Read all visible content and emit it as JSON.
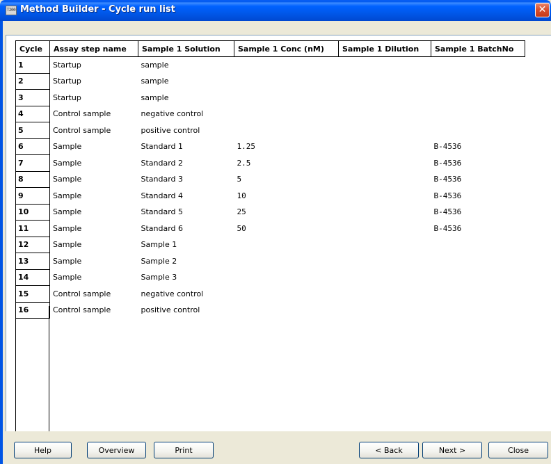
{
  "window": {
    "title": "Method Builder - Cycle run list",
    "icon_text": "T200",
    "close_glyph": "✕"
  },
  "table": {
    "headers": [
      "Cycle",
      "Assay step name",
      "Sample 1 Solution",
      "Sample 1 Conc (nM)",
      "Sample 1 Dilution",
      "Sample 1 BatchNo"
    ],
    "rows": [
      {
        "cycle": "1",
        "step": "Startup",
        "solution": "sample",
        "conc": "",
        "dilution": "",
        "batch": ""
      },
      {
        "cycle": "2",
        "step": "Startup",
        "solution": "sample",
        "conc": "",
        "dilution": "",
        "batch": ""
      },
      {
        "cycle": "3",
        "step": "Startup",
        "solution": "sample",
        "conc": "",
        "dilution": "",
        "batch": ""
      },
      {
        "cycle": "4",
        "step": "Control sample",
        "solution": "negative control",
        "conc": "",
        "dilution": "",
        "batch": ""
      },
      {
        "cycle": "5",
        "step": "Control sample",
        "solution": "positive control",
        "conc": "",
        "dilution": "",
        "batch": ""
      },
      {
        "cycle": "6",
        "step": "Sample",
        "solution": "Standard 1",
        "conc": "1.25",
        "dilution": "",
        "batch": "B-4536"
      },
      {
        "cycle": "7",
        "step": "Sample",
        "solution": "Standard 2",
        "conc": "2.5",
        "dilution": "",
        "batch": "B-4536"
      },
      {
        "cycle": "8",
        "step": "Sample",
        "solution": "Standard 3",
        "conc": "5",
        "dilution": "",
        "batch": "B-4536"
      },
      {
        "cycle": "9",
        "step": "Sample",
        "solution": "Standard 4",
        "conc": "10",
        "dilution": "",
        "batch": "B-4536"
      },
      {
        "cycle": "10",
        "step": "Sample",
        "solution": "Standard 5",
        "conc": "25",
        "dilution": "",
        "batch": "B-4536"
      },
      {
        "cycle": "11",
        "step": "Sample",
        "solution": "Standard 6",
        "conc": "50",
        "dilution": "",
        "batch": "B-4536"
      },
      {
        "cycle": "12",
        "step": "Sample",
        "solution": "Sample 1",
        "conc": "",
        "dilution": "",
        "batch": ""
      },
      {
        "cycle": "13",
        "step": "Sample",
        "solution": "Sample 2",
        "conc": "",
        "dilution": "",
        "batch": ""
      },
      {
        "cycle": "14",
        "step": "Sample",
        "solution": "Sample 3",
        "conc": "",
        "dilution": "",
        "batch": ""
      },
      {
        "cycle": "15",
        "step": "Control sample",
        "solution": "negative control",
        "conc": "",
        "dilution": "",
        "batch": ""
      },
      {
        "cycle": "16",
        "step": "Control sample",
        "solution": "positive control",
        "conc": "",
        "dilution": "",
        "batch": ""
      }
    ]
  },
  "buttons": {
    "help": "Help",
    "overview": "Overview",
    "print": "Print",
    "back": "< Back",
    "next": "Next >",
    "close": "Close"
  },
  "colors": {
    "titlebar": "#0055e5",
    "window_bg": "#ece9d8",
    "close_button": "#d9502e"
  }
}
